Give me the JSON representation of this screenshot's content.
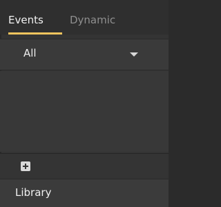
{
  "tabs": {
    "events_label": "Events",
    "dynamic_label": "Dynamic",
    "accent_color": "#f3c45e"
  },
  "filter": {
    "selected": "All",
    "icon": "chevron-down-icon"
  },
  "add": {
    "icon": "plus-square-icon"
  },
  "library": {
    "label": "Library"
  }
}
